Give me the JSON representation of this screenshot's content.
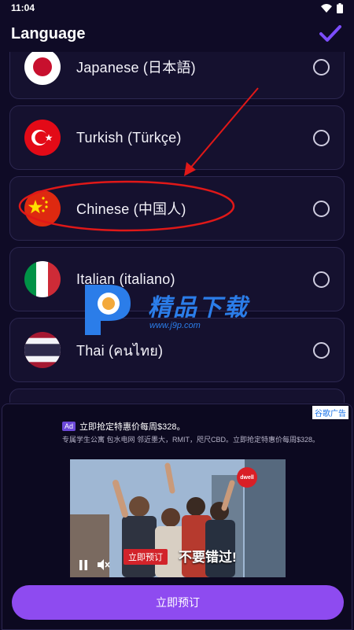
{
  "status_bar": {
    "time": "11:04"
  },
  "header": {
    "title": "Language"
  },
  "languages": [
    {
      "label": "Japanese (日本語)"
    },
    {
      "label": "Turkish (Türkçe)"
    },
    {
      "label": "Chinese (中国人)"
    },
    {
      "label": "Italian (italiano)"
    },
    {
      "label": "Thai (คนไทย)"
    }
  ],
  "watermark": {
    "text": "精品下载",
    "url": "www.j9p.com"
  },
  "ad": {
    "choices_label": "谷歌广告",
    "badge": "Ad",
    "headline": "立即抢定特惠价每周$328。",
    "subtext": "专属学生公寓 包水电网 邻近墨大，RMIT，咫尺CBD。立即抢定特惠价每周$328。",
    "video_cta_tag": "立即预订",
    "video_overlay_text": "不要错过!",
    "brand_logo_text": "dwell",
    "cta_label": "立即预订"
  },
  "colors": {
    "background": "#0f0b26",
    "card": "#15112f",
    "accent": "#7c4dff",
    "cta": "#8e4bf0",
    "annotation": "#e01818"
  }
}
